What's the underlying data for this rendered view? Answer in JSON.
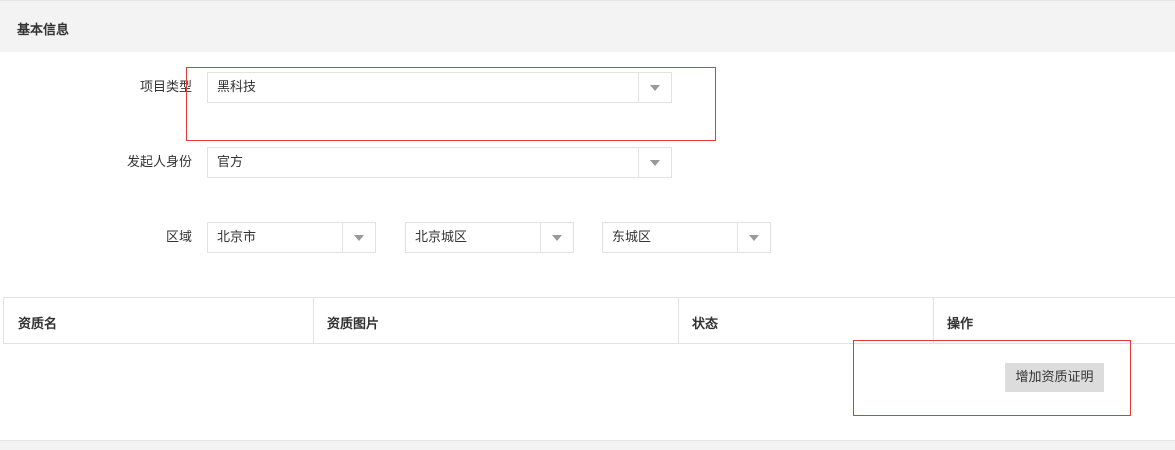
{
  "section": {
    "title": "基本信息"
  },
  "form": {
    "project_type": {
      "label": "项目类型",
      "value": "黑科技"
    },
    "initiator_identity": {
      "label": "发起人身份",
      "value": "官方"
    },
    "region": {
      "label": "区域",
      "province": "北京市",
      "city": "北京城区",
      "district": "东城区"
    }
  },
  "table": {
    "columns": [
      "资质名",
      "资质图片",
      "状态",
      "操作"
    ]
  },
  "actions": {
    "add_qualification_label": "增加资质证明"
  },
  "colors": {
    "highlight": "#e03a3a",
    "header_bg": "#f3f3f3",
    "button_bg": "#dcdcdc"
  }
}
